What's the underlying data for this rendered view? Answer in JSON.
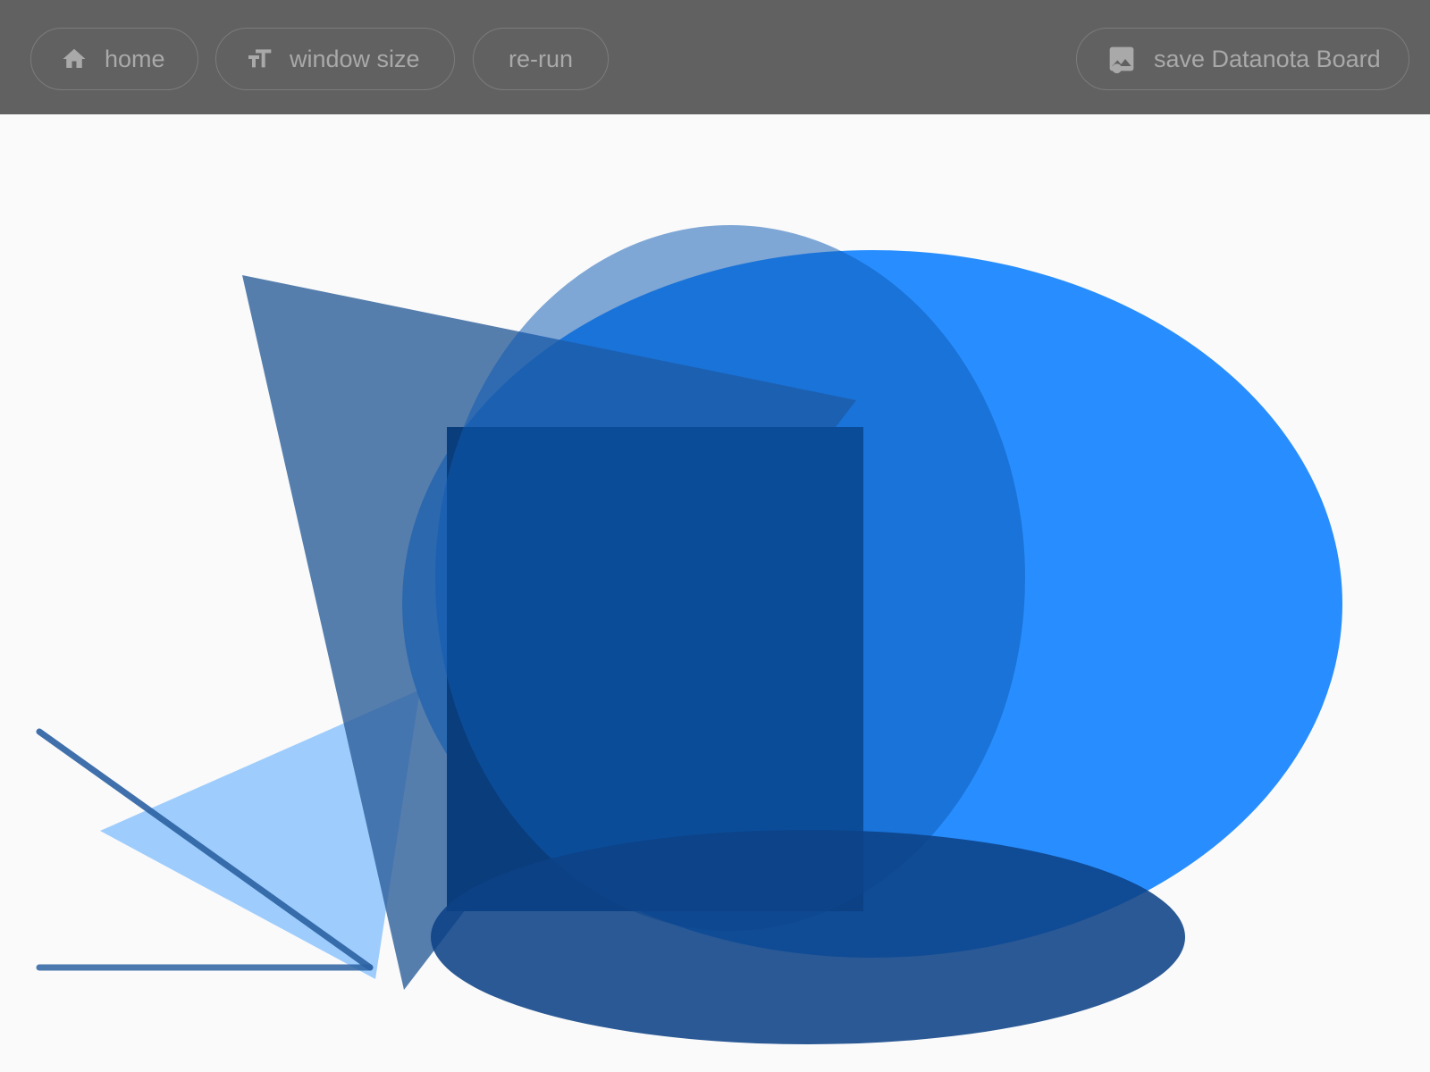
{
  "toolbar": {
    "home": {
      "label": "home",
      "icon": "home-icon"
    },
    "window_size": {
      "label": "window size",
      "icon": "text-size-icon"
    },
    "rerun": {
      "label": "re-run"
    },
    "save": {
      "label": "save Datanota Board",
      "icon": "image-icon"
    }
  },
  "colors": {
    "toolbar_bg": "#616161",
    "button_text": "#a9a9a9",
    "canvas_bg": "#fafafa",
    "bright_blue": "#0a7eff",
    "mid_blue": "#1565c0",
    "steel_blue": "#2c5d9a",
    "light_blue": "#9ecdfd",
    "navy": "#0a3d7c"
  }
}
